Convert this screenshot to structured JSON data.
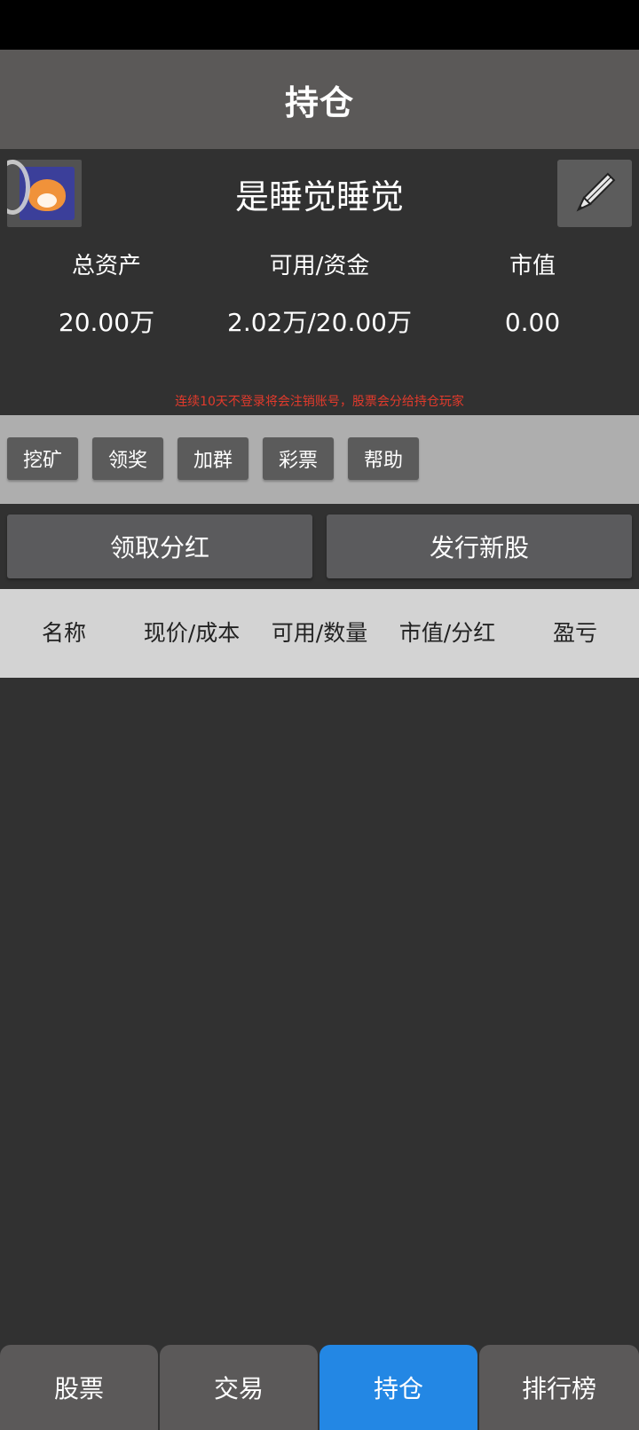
{
  "header": {
    "title": "持仓"
  },
  "profile": {
    "avatar_icon": "shiba-dog-avatar",
    "username": "是睡觉睡觉",
    "edit_icon": "pencil-icon"
  },
  "stats": [
    {
      "label": "总资产",
      "value": "20.00万"
    },
    {
      "label": "可用/资金",
      "value": "2.02万/20.00万"
    },
    {
      "label": "市值",
      "value": "0.00"
    }
  ],
  "notice": "连续10天不登录将会注销账号，股票会分给持仓玩家",
  "tools": [
    "挖矿",
    "领奖",
    "加群",
    "彩票",
    "帮助"
  ],
  "actions": {
    "dividend": "领取分红",
    "issue": "发行新股"
  },
  "table": {
    "columns": [
      "名称",
      "现价/成本",
      "可用/数量",
      "市值/分红",
      "盈亏"
    ],
    "rows": []
  },
  "nav": {
    "items": [
      "股票",
      "交易",
      "持仓",
      "排行榜"
    ],
    "active": "持仓"
  },
  "colors": {
    "background": "#313131",
    "title_bar": "#5b5958",
    "tools_bar": "#aeaeae",
    "table_header": "#d3d3d3",
    "notice": "#e23a2c",
    "active_tab": "#2387e4"
  }
}
